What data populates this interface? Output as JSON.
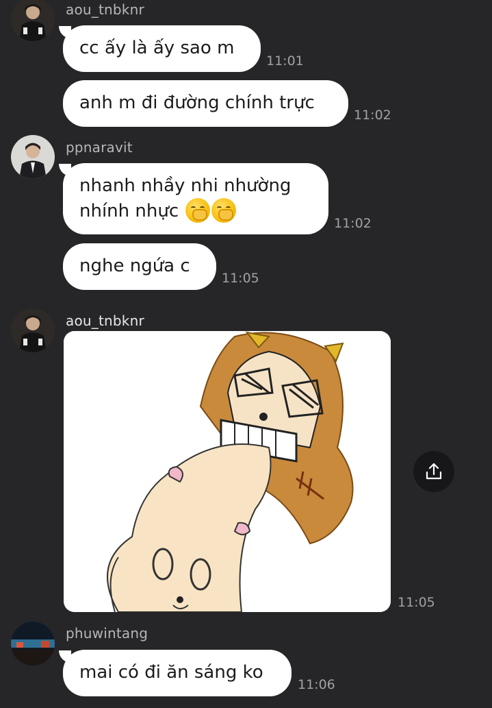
{
  "messages": [
    {
      "sender": "aou_tnbknr",
      "text": "cc ấy là ấy sao m",
      "time": "11:01"
    },
    {
      "text": "anh m đi đường chính trực",
      "time": "11:02"
    },
    {
      "sender": "ppnaravit",
      "line1": "nhanh nhầy nhi nhường",
      "line2": "nhính nhực",
      "emoji": "yawning-face-emoji",
      "time": "11:02"
    },
    {
      "text": "nghe ngứa c",
      "time": "11:05"
    },
    {
      "sender": "aou_tnbknr",
      "image": "cartoon-sticker-image",
      "time": "11:05"
    },
    {
      "sender": "phuwintang",
      "text": "mai có đi ăn sáng ko",
      "time": "11:06"
    }
  ],
  "icons": {
    "share": "share-upload-icon"
  },
  "colors": {
    "background": "#262628",
    "bubble": "#ffffff",
    "timestamp": "#a2a2a6",
    "sender": "#b7b7bb"
  }
}
